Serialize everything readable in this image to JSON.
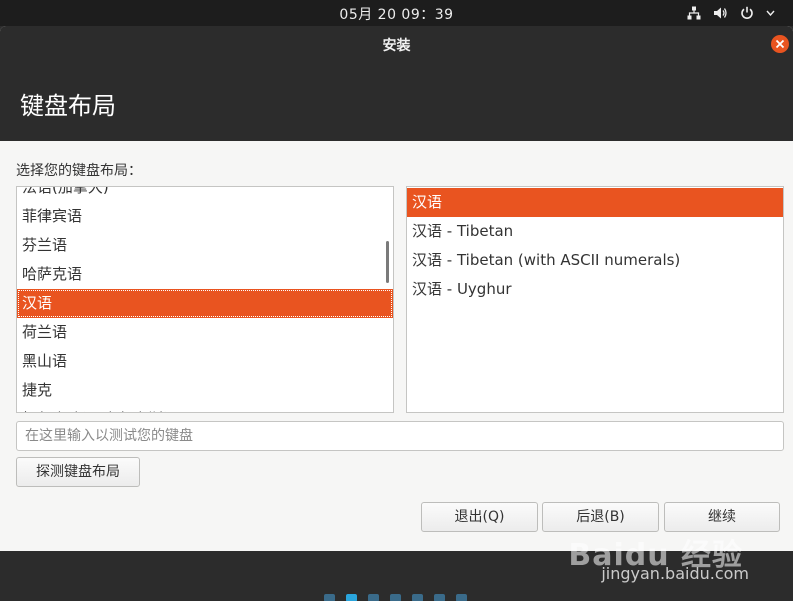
{
  "topbar": {
    "datetime": "05月 20  09：39",
    "icons": [
      "network-icon",
      "volume-icon",
      "power-icon"
    ]
  },
  "window": {
    "title": "安装",
    "close_icon": "close-icon",
    "heading": "键盘布局"
  },
  "layout_prompt": "选择您的键盘布局：",
  "layouts": {
    "items": [
      "法语(加拿大)",
      "菲律宾语",
      "芬兰语",
      "哈萨克语",
      "汉语",
      "荷兰语",
      "黑山语",
      "捷克",
      "柯尔克孜语(吉尔吉斯语)"
    ],
    "selected": "汉语"
  },
  "variants": {
    "items": [
      "汉语",
      "汉语 - Tibetan",
      "汉语 - Tibetan (with ASCII numerals)",
      "汉语 - Uyghur"
    ],
    "selected": "汉语"
  },
  "test_input": {
    "value": "",
    "placeholder": "在这里输入以测试您的键盘"
  },
  "buttons": {
    "detect": "探测键盘布局",
    "quit": "退出(Q)",
    "back": "后退(B)",
    "continue": "继续"
  },
  "progress": {
    "total_steps": 7,
    "current_step": 2
  },
  "watermark": {
    "brand": "Baidu 经验",
    "url": "jingyan.baidu.com"
  },
  "colors": {
    "accent": "#e95420",
    "dark": "#2c2c2c",
    "progress_active": "#2aa5dd"
  }
}
